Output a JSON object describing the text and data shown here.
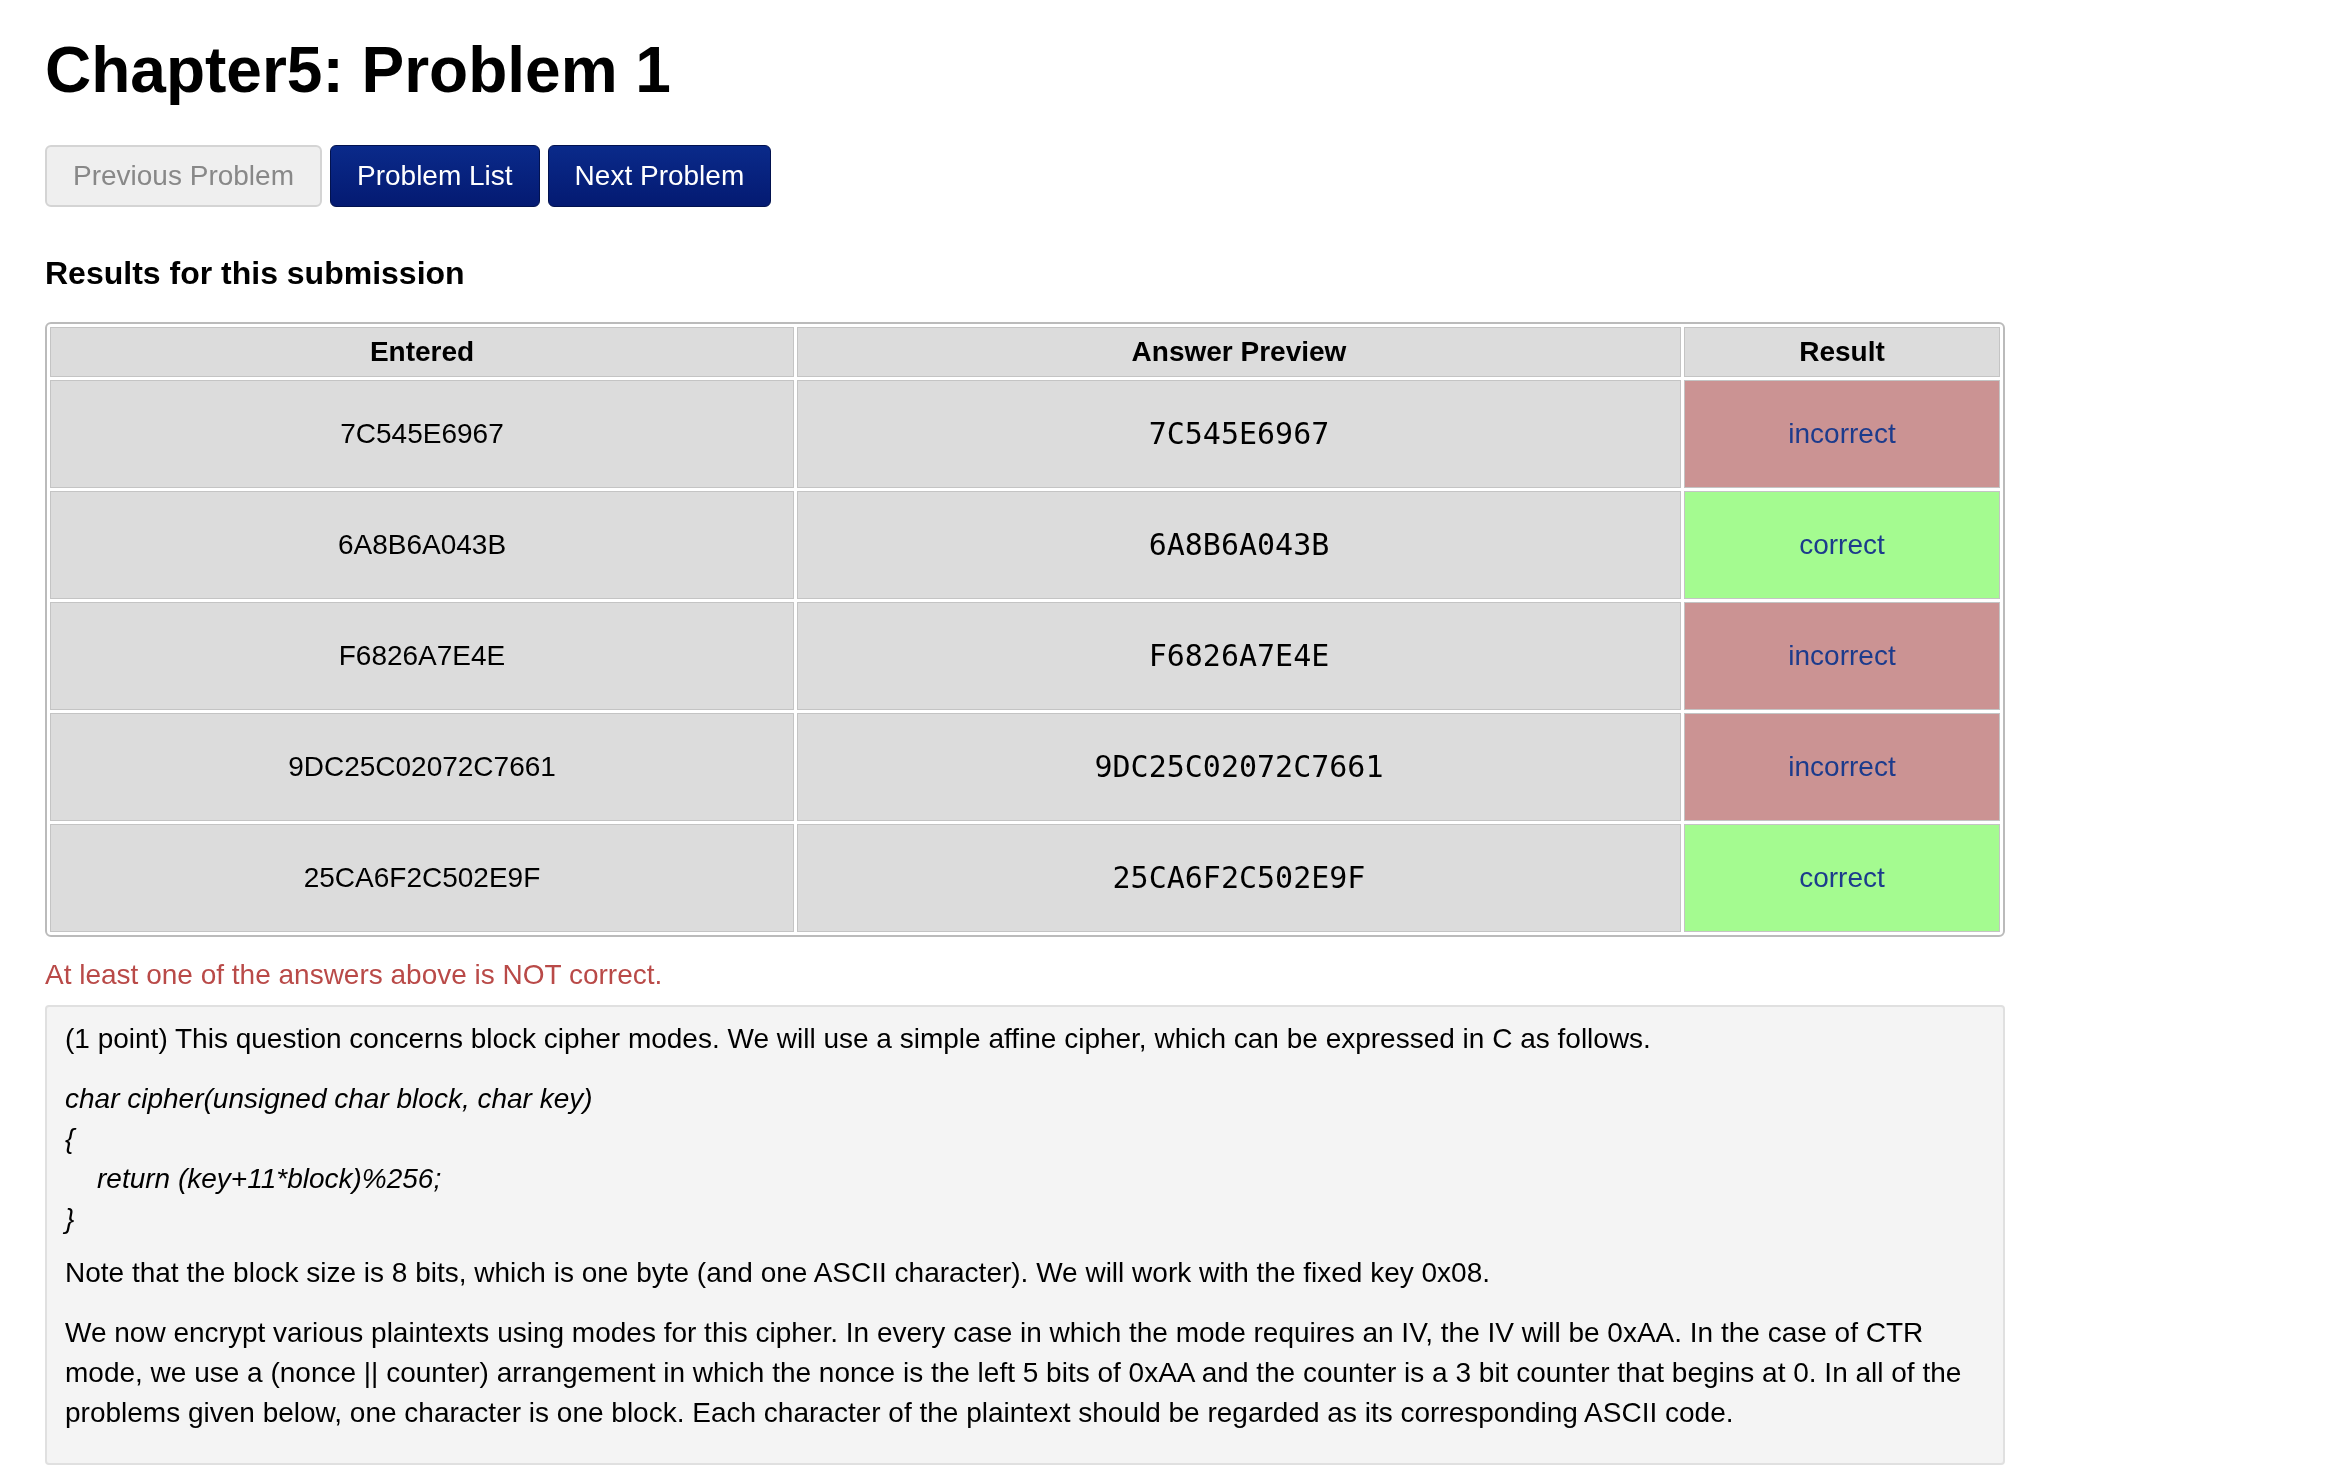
{
  "title": "Chapter5: Problem 1",
  "nav_buttons": [
    {
      "label": "Previous Problem",
      "disabled": true
    },
    {
      "label": "Problem List",
      "disabled": false
    },
    {
      "label": "Next Problem",
      "disabled": false
    }
  ],
  "results_heading": "Results for this submission",
  "table": {
    "columns": [
      "Entered",
      "Answer Preview",
      "Result"
    ],
    "rows": [
      {
        "entered": "7C545E6967",
        "preview": "7C545E6967",
        "result": "incorrect",
        "correct": false
      },
      {
        "entered": "6A8B6A043B",
        "preview": "6A8B6A043B",
        "result": "correct",
        "correct": true
      },
      {
        "entered": "F6826A7E4E",
        "preview": "F6826A7E4E",
        "result": "incorrect",
        "correct": false
      },
      {
        "entered": "9DC25C02072C7661",
        "preview": "9DC25C02072C7661",
        "result": "incorrect",
        "correct": false
      },
      {
        "entered": "25CA6F2C502E9F",
        "preview": "25CA6F2C502E9F",
        "result": "correct",
        "correct": true
      }
    ]
  },
  "error_message": "At least one of the answers above is NOT correct.",
  "problem": {
    "intro": "(1 point) This question concerns block cipher modes. We will use a simple affine cipher, which can be expressed in C as follows.",
    "code_lines": [
      {
        "text": "char cipher(unsigned char block, char key)",
        "indented": false
      },
      {
        "text": "{",
        "indented": false
      },
      {
        "text": "return (key+11*block)%256;",
        "indented": true
      },
      {
        "text": "}",
        "indented": false
      }
    ],
    "paragraphs": [
      "Note that the block size is 8 bits, which is one byte (and one ASCII character). We will work with the fixed key 0x08.",
      "We now encrypt various plaintexts using modes for this cipher. In every case in which the mode requires an IV, the IV will be 0xAA. In the case of CTR mode, we use a (nonce || counter) arrangement in which the nonce is the left 5 bits of 0xAA and the counter is a 3 bit counter that begins at 0. In all of the problems given below, one character is one block. Each character of the plaintext should be regarded as its corresponding ASCII code."
    ]
  }
}
